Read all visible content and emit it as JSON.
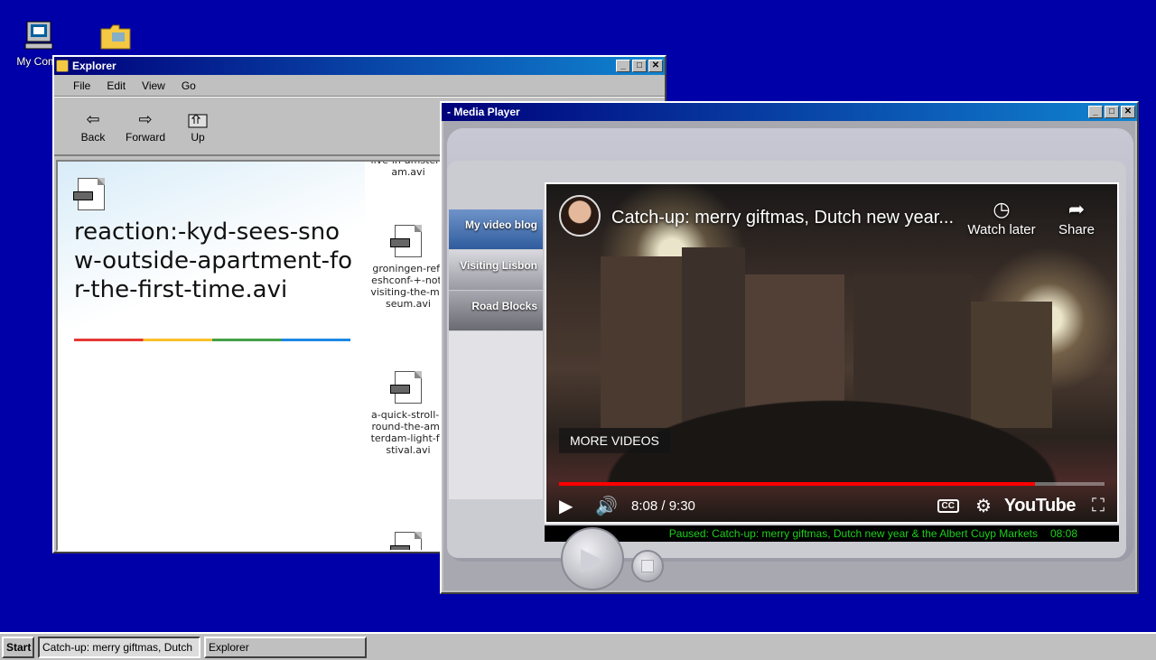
{
  "desktop": {
    "icons": [
      {
        "label": "My Comp",
        "icon": "computer-icon"
      },
      {
        "label": "",
        "icon": "folder-icon"
      }
    ]
  },
  "explorer": {
    "title": "Explorer",
    "menu": [
      "File",
      "Edit",
      "View",
      "Go"
    ],
    "toolbar": {
      "back": "Back",
      "forward": "Forward",
      "up": "Up"
    },
    "preview_title": "reaction:-kyd-sees-snow-outside-apartment-for-the-first-time.avi",
    "files": [
      {
        "name": "live-in-amsterdam.avi"
      },
      {
        "name": "groningen-refreshconf-+-not-visiting-the-museum.avi"
      },
      {
        "name": "a-quick-stroll-around-the-amsterdam-light-festival.avi"
      },
      {
        "name": ""
      }
    ]
  },
  "media_player": {
    "title": "- Media Player",
    "nav": [
      "My video blog",
      "Visiting Lisbon",
      "Road Blocks"
    ],
    "video": {
      "title": "Catch-up: merry giftmas, Dutch new year...",
      "watch_later": "Watch later",
      "share": "Share",
      "more_videos": "MORE VIDEOS",
      "time": "8:08 / 9:30",
      "progress": 0.872,
      "brand": "YouTube"
    },
    "status": {
      "text": "Paused: Catch-up: merry giftmas, Dutch new year & the Albert Cuyp Markets",
      "time": "08:08"
    }
  },
  "taskbar": {
    "start": "Start",
    "tasks": [
      "Catch-up: merry giftmas, Dutch",
      "Explorer"
    ]
  },
  "colors": {
    "desktop": "#0000a8",
    "status_text": "#1dcf1d",
    "progress": "#ff0000"
  }
}
